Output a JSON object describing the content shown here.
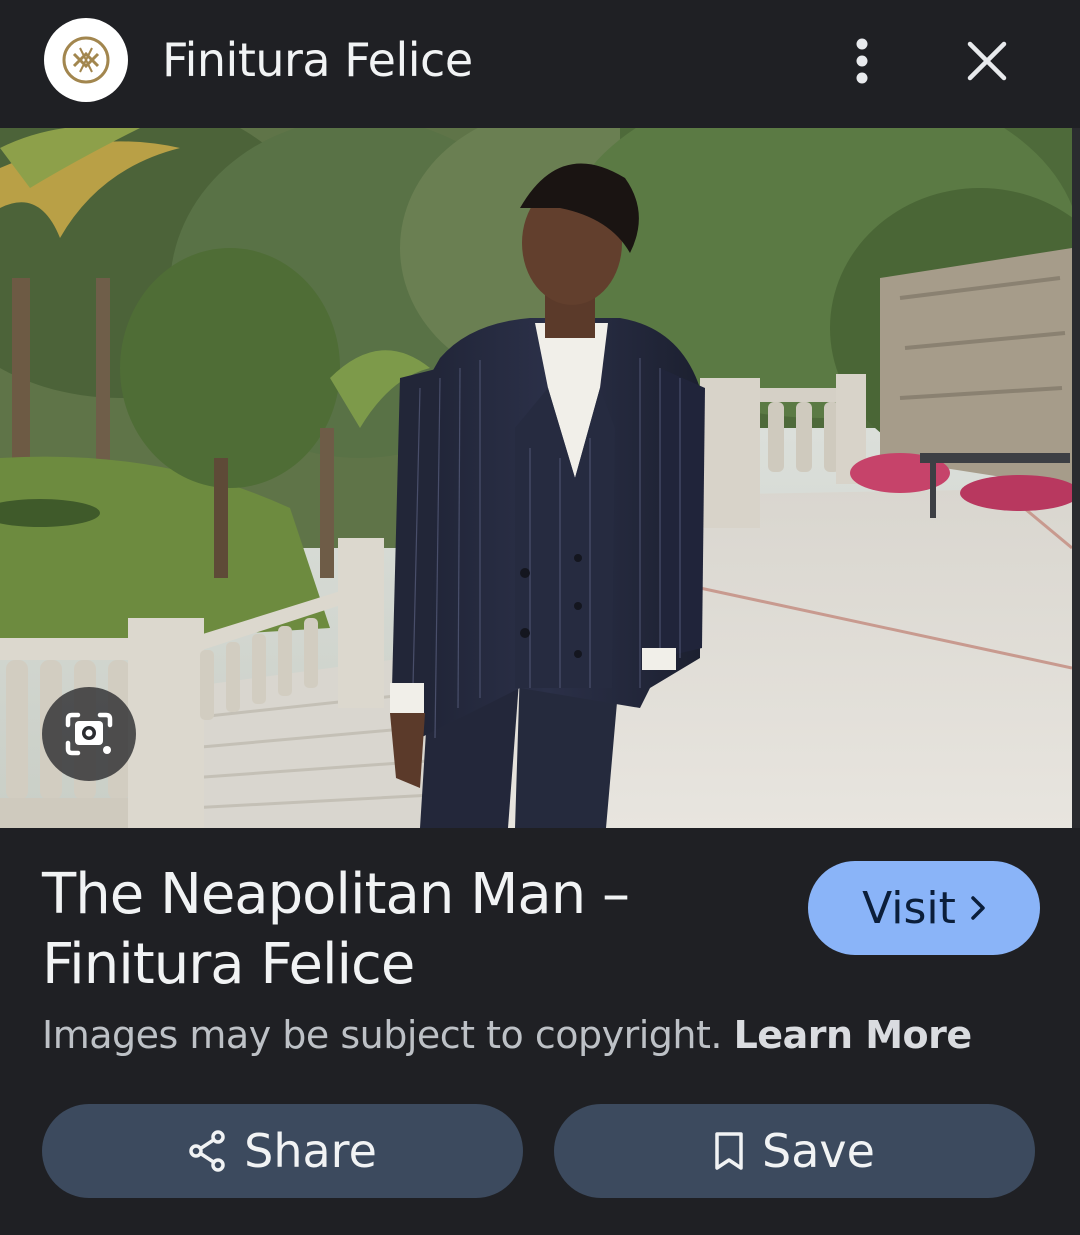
{
  "header": {
    "site_name": "Finitura Felice",
    "logo_icon": "finitura-felice-logo-icon",
    "more_icon": "more-vert-icon",
    "close_icon": "close-icon"
  },
  "image": {
    "lens_icon": "google-lens-icon"
  },
  "result": {
    "title_line1": "The Neapolitan Man –",
    "title_line2": "Finitura Felice",
    "visit_label": "Visit",
    "copyright_text": "Images may be subject to copyright.",
    "learn_more_label": "Learn More"
  },
  "actions": {
    "share_label": "Share",
    "save_label": "Save"
  },
  "colors": {
    "background": "#1f2024",
    "visit_button": "#8ab4f8",
    "action_button": "#3c4a5e"
  }
}
